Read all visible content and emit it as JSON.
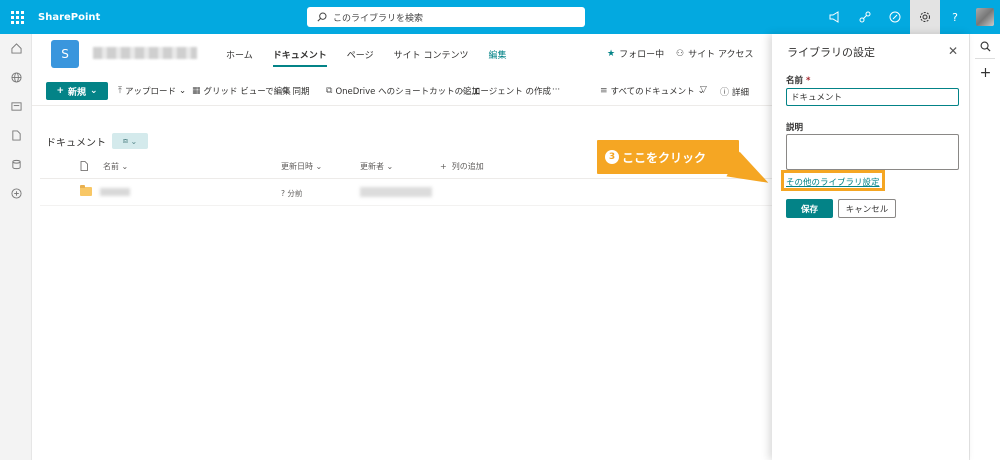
{
  "suitebar": {
    "app_name": "SharePoint",
    "search_placeholder": "このライブラリを検索",
    "accent": "#03a9e0"
  },
  "site": {
    "logo_letter": "S",
    "nav": [
      {
        "label": "ホーム"
      },
      {
        "label": "ドキュメント"
      },
      {
        "label": "ページ"
      },
      {
        "label": "サイト コンテンツ"
      },
      {
        "label": "編集"
      }
    ],
    "follow_label": "フォロー中",
    "access_label": "サイト アクセス"
  },
  "commandbar": {
    "new_label": "新規",
    "upload_label": "アップロード",
    "grid_edit_label": "グリッド ビューで編集",
    "sync_label": "同期",
    "shortcut_label": "OneDrive へのショートカットの追加",
    "agent_label": "エージェント の作成",
    "more_label": "···",
    "view_label": "すべてのドキュメント",
    "details_label": "詳細"
  },
  "library": {
    "title": "ドキュメント",
    "columns": {
      "name": "名前",
      "modified": "更新日時",
      "modified_by": "更新者",
      "add_column": "列の追加"
    },
    "rows": [
      {
        "modified": "? 分前"
      }
    ]
  },
  "panel": {
    "title": "ライブラリの設定",
    "name_label": "名前",
    "required_mark": "*",
    "name_value": "ドキュメント",
    "description_label": "説明",
    "more_settings_link": "その他のライブラリ設定",
    "save_label": "保存",
    "cancel_label": "キャンセル"
  },
  "annotation": {
    "number": "3",
    "text": "ここをクリック",
    "color": "#f5a623"
  },
  "colors": {
    "teal": "#038387",
    "panel_bg": "#ffffff"
  }
}
